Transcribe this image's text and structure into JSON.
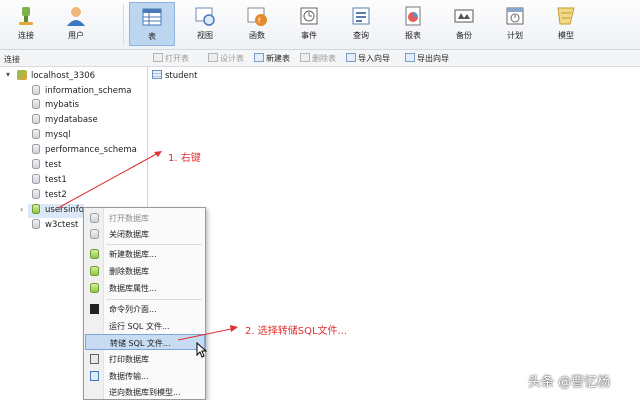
{
  "toolbar": {
    "items": [
      {
        "label": "连接",
        "icon": "connect-icon"
      },
      {
        "label": "用户",
        "icon": "user-icon"
      },
      {
        "label": "表",
        "icon": "table-icon",
        "active": true
      },
      {
        "label": "视图",
        "icon": "view-icon"
      },
      {
        "label": "函数",
        "icon": "function-icon"
      },
      {
        "label": "事件",
        "icon": "event-icon"
      },
      {
        "label": "查询",
        "icon": "query-icon"
      },
      {
        "label": "报表",
        "icon": "report-icon"
      },
      {
        "label": "备份",
        "icon": "backup-icon"
      },
      {
        "label": "计划",
        "icon": "schedule-icon"
      },
      {
        "label": "模型",
        "icon": "model-icon"
      }
    ]
  },
  "subbar": {
    "connection_label": "连接",
    "buttons": [
      {
        "label": "打开表",
        "enabled": false
      },
      {
        "label": "设计表",
        "enabled": false
      },
      {
        "label": "新建表",
        "enabled": true
      },
      {
        "label": "删除表",
        "enabled": false
      },
      {
        "label": "导入向导",
        "enabled": true
      },
      {
        "label": "导出向导",
        "enabled": true
      }
    ]
  },
  "tree": {
    "connection": "localhost_3306",
    "databases": [
      "information_schema",
      "mybatis",
      "mydatabase",
      "mysql",
      "performance_schema",
      "test",
      "test1",
      "test2",
      "usersinfo",
      "w3ctest"
    ],
    "selected": "usersinfo"
  },
  "content": {
    "objects": [
      "student"
    ]
  },
  "context_menu": {
    "items": [
      {
        "label": "打开数据库",
        "enabled": false
      },
      {
        "label": "关闭数据库",
        "enabled": true
      },
      {
        "label": "新建数据库...",
        "enabled": true
      },
      {
        "label": "删除数据库",
        "enabled": true
      },
      {
        "label": "数据库属性...",
        "enabled": true
      },
      {
        "label": "命令列介面...",
        "enabled": true
      },
      {
        "label": "运行 SQL 文件...",
        "enabled": true
      },
      {
        "label": "转储 SQL 文件...",
        "enabled": true,
        "highlighted": true
      },
      {
        "label": "打印数据库",
        "enabled": true
      },
      {
        "label": "数据传输...",
        "enabled": true
      },
      {
        "label": "逆向数据库到模型...",
        "enabled": true
      }
    ]
  },
  "annotations": {
    "step1": "1. 右键",
    "step2": "2. 选择转储SQL文件..."
  },
  "watermark": "头条 @曹忆杨",
  "colors": {
    "annotation": "#e03030",
    "active_tool": "#bcd6f0",
    "menu_highlight": "#c7dcf3"
  }
}
